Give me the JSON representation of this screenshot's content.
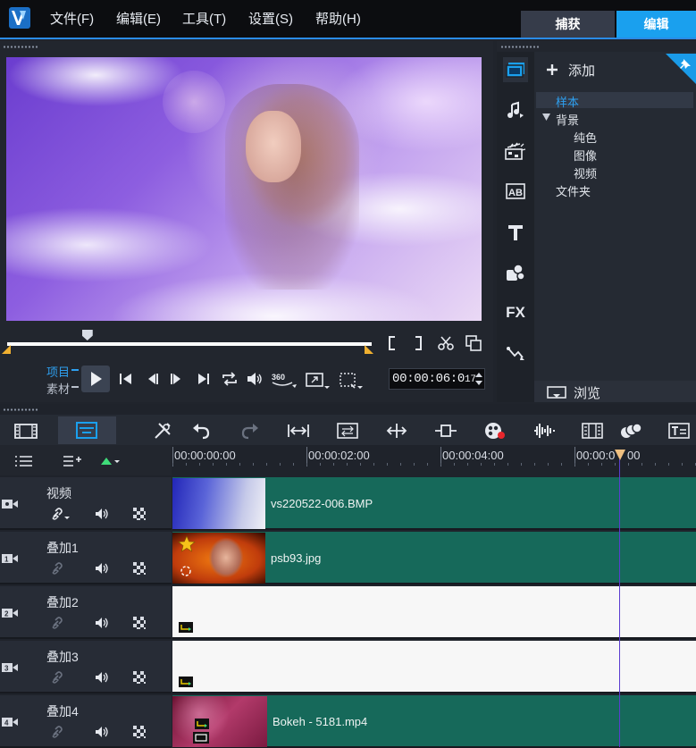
{
  "menubar": {
    "items": [
      "文件(F)",
      "编辑(E)",
      "工具(T)",
      "设置(S)",
      "帮助(H)"
    ],
    "tabs": {
      "capture": "捕获",
      "edit": "编辑"
    }
  },
  "player": {
    "mode_project": "项目",
    "mode_clip": "素材",
    "timecode": "00:00:06:0",
    "timecode_frame": "17",
    "scrub_position": 0.22,
    "icons": [
      "play-icon",
      "previous-icon",
      "step-back-icon",
      "step-forward-icon",
      "next-icon",
      "repeat-icon",
      "volume-icon",
      "360-icon",
      "resize-icon",
      "crop-icon",
      "mark-in-icon",
      "mark-out-icon",
      "split-icon",
      "copy-icon"
    ]
  },
  "library": {
    "add_label": "添加",
    "browse_label": "浏览",
    "tree": {
      "sample": "样本",
      "background": "背景",
      "solid_color": "纯色",
      "image": "图像",
      "video": "视频",
      "folder": "文件夹"
    },
    "sidebar_icons": [
      "media-icon",
      "music-icon",
      "transition-icon",
      "title-icon",
      "text-icon",
      "graphics-icon",
      "fx-icon",
      "path-icon"
    ],
    "fx_label": "FX"
  },
  "timeline": {
    "ruler": [
      "00:00:00:00",
      "00:00:02:00",
      "00:00:04:00",
      "00:00:0"
    ],
    "ruler_tail": "00",
    "tracks": [
      {
        "name": "视频",
        "badge": "video",
        "clip": "vs220522-006.BMP",
        "lane": "green"
      },
      {
        "name": "叠加1",
        "badge": "1",
        "clip": "psb93.jpg",
        "lane": "green"
      },
      {
        "name": "叠加2",
        "badge": "2",
        "clip": "",
        "lane": "white"
      },
      {
        "name": "叠加3",
        "badge": "3",
        "clip": "",
        "lane": "white"
      },
      {
        "name": "叠加4",
        "badge": "4",
        "clip": "Bokeh - 5181.mp4",
        "lane": "green"
      }
    ]
  },
  "colors": {
    "accent": "#1aa0ee",
    "clip_green": "#16695a",
    "mark_orange": "#f0b030"
  }
}
